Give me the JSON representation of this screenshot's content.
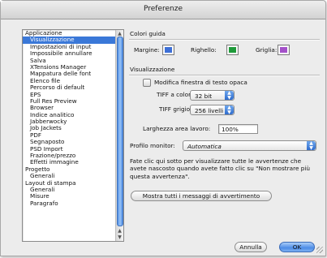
{
  "window": {
    "title": "Preferenze"
  },
  "sidebar": {
    "items": [
      {
        "label": "Applicazione",
        "level": 0,
        "selected": false
      },
      {
        "label": "Visualizzazione",
        "level": 1,
        "selected": true
      },
      {
        "label": "Impostazioni di input",
        "level": 1,
        "selected": false
      },
      {
        "label": "Impossibile annullare",
        "level": 1,
        "selected": false
      },
      {
        "label": "Salva",
        "level": 1,
        "selected": false
      },
      {
        "label": "XTensions Manager",
        "level": 1,
        "selected": false
      },
      {
        "label": "Mappatura delle font",
        "level": 1,
        "selected": false
      },
      {
        "label": "Elenco file",
        "level": 1,
        "selected": false
      },
      {
        "label": "Percorso di default",
        "level": 1,
        "selected": false
      },
      {
        "label": "EPS",
        "level": 1,
        "selected": false
      },
      {
        "label": "Full Res Preview",
        "level": 1,
        "selected": false
      },
      {
        "label": "Browser",
        "level": 1,
        "selected": false
      },
      {
        "label": "Indice analitico",
        "level": 1,
        "selected": false
      },
      {
        "label": "Jabberwocky",
        "level": 1,
        "selected": false
      },
      {
        "label": "Job Jackets",
        "level": 1,
        "selected": false
      },
      {
        "label": "PDF",
        "level": 1,
        "selected": false
      },
      {
        "label": "Segnaposto",
        "level": 1,
        "selected": false
      },
      {
        "label": "PSD Import",
        "level": 1,
        "selected": false
      },
      {
        "label": "Frazione/prezzo",
        "level": 1,
        "selected": false
      },
      {
        "label": "Effetti immagine",
        "level": 1,
        "selected": false
      },
      {
        "label": "Progetto",
        "level": 0,
        "selected": false
      },
      {
        "label": "Generali",
        "level": 1,
        "selected": false
      },
      {
        "label": "Layout di stampa",
        "level": 0,
        "selected": false
      },
      {
        "label": "Generali",
        "level": 1,
        "selected": false
      },
      {
        "label": "Misure",
        "level": 1,
        "selected": false
      },
      {
        "label": "Paragrafo",
        "level": 1,
        "selected": false
      }
    ]
  },
  "guide_colors": {
    "section_label": "Colori guida",
    "margin_label": "Margine:",
    "margin_color": "#3d6fd6",
    "ruler_label": "Righello:",
    "ruler_color": "#1f9a3a",
    "grid_label": "Griglia:",
    "grid_color": "#a451c9"
  },
  "display": {
    "section_label": "Visualizzazione",
    "opaque_text_edit_label": "Modifica finestra di testo opaca",
    "opaque_text_edit_checked": false,
    "color_tiff_label": "TIFF a colori:",
    "color_tiff_value": "32 bit",
    "gray_tiff_label": "TIFF grigio:",
    "gray_tiff_value": "256 livelli",
    "pasteboard_label": "Larghezza area lavoro:",
    "pasteboard_value": "100%"
  },
  "monitor": {
    "label": "Profilo monitor:",
    "value": "Automatica"
  },
  "warnings": {
    "text": "Fate clic qui sotto per visualizzare tutte le avvertenze che avete nascosto quando avete fatto clic su \"Non mostrare più questa avvertenza\".",
    "button_label": "Mostra tutti i messaggi di avvertimento"
  },
  "footer": {
    "cancel_label": "Annulla",
    "ok_label": "OK"
  }
}
